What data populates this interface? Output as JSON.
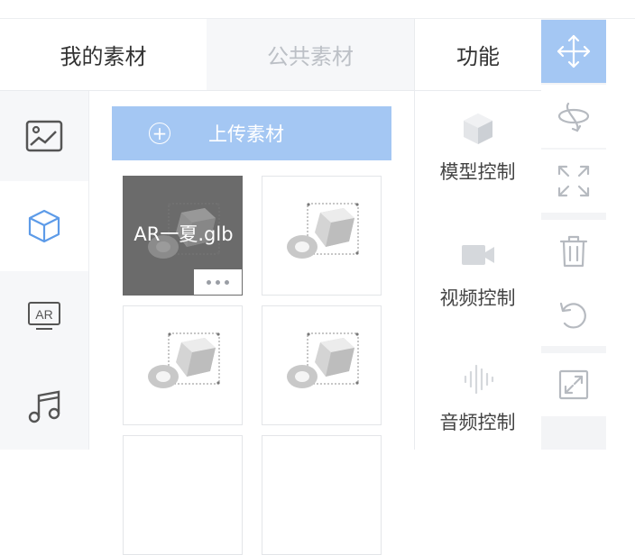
{
  "tabs": {
    "mine": "我的素材",
    "public": "公共素材",
    "function": "功能"
  },
  "categories": [
    {
      "icon": "image-icon",
      "active": false
    },
    {
      "icon": "cube-icon",
      "active": true
    },
    {
      "icon": "ar-icon",
      "active": false
    },
    {
      "icon": "music-icon",
      "active": false
    }
  ],
  "upload": {
    "label": "上传素材",
    "icon": "plus-circle-icon"
  },
  "assets": [
    {
      "name": "AR一夏.glb",
      "selected": true
    },
    {
      "name": "",
      "selected": false
    },
    {
      "name": "",
      "selected": false
    },
    {
      "name": "",
      "selected": false
    }
  ],
  "functions": [
    {
      "label": "模型控制",
      "icon": "model-icon"
    },
    {
      "label": "视频控制",
      "icon": "video-camera-icon"
    },
    {
      "label": "音频控制",
      "icon": "audio-wave-icon"
    }
  ],
  "tools": [
    {
      "icon": "move-icon",
      "active": true
    },
    {
      "icon": "rotate-icon",
      "active": false
    },
    {
      "icon": "scale-icon",
      "active": false
    },
    {
      "icon": "trash-icon",
      "active": false
    },
    {
      "icon": "undo-icon",
      "active": false
    },
    {
      "icon": "fullscreen-icon",
      "active": false
    }
  ],
  "colors": {
    "accent": "#a4c7f3",
    "selected_card": "#6b6b6b",
    "icon_gray": "#b6bac0"
  }
}
